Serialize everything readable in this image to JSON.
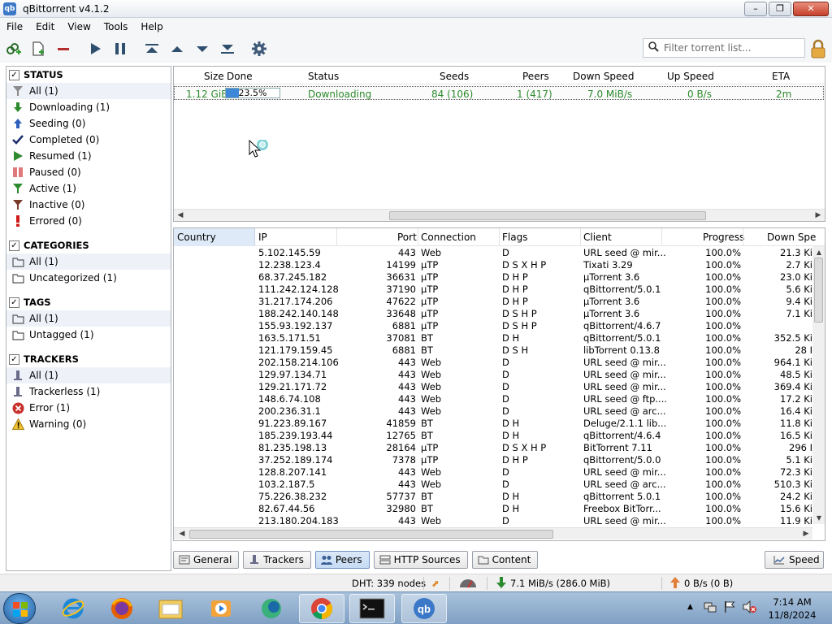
{
  "window": {
    "title": "qBittorrent v4.1.2"
  },
  "menu": [
    "File",
    "Edit",
    "View",
    "Tools",
    "Help"
  ],
  "toolbar": {
    "filter_placeholder": "Filter torrent list..."
  },
  "sidebar": {
    "status_header": "STATUS",
    "status_items": [
      {
        "label": "All (1)",
        "icon": "filter-icon"
      },
      {
        "label": "Downloading (1)",
        "icon": "arrow-down-icon"
      },
      {
        "label": "Seeding (0)",
        "icon": "arrow-up-icon"
      },
      {
        "label": "Completed (0)",
        "icon": "checkmark-icon"
      },
      {
        "label": "Resumed (1)",
        "icon": "play-icon"
      },
      {
        "label": "Paused (0)",
        "icon": "pause-icon"
      },
      {
        "label": "Active (1)",
        "icon": "filter-green-icon"
      },
      {
        "label": "Inactive (0)",
        "icon": "filter-red-icon"
      },
      {
        "label": "Errored (0)",
        "icon": "exclamation-icon"
      }
    ],
    "categories_header": "CATEGORIES",
    "categories_items": [
      "All (1)",
      "Uncategorized (1)"
    ],
    "tags_header": "TAGS",
    "tags_items": [
      "All (1)",
      "Untagged (1)"
    ],
    "trackers_header": "TRACKERS",
    "trackers_items": [
      {
        "label": "All (1)",
        "icon": "tracker-icon"
      },
      {
        "label": "Trackerless (1)",
        "icon": "tracker-icon"
      },
      {
        "label": "Error (1)",
        "icon": "error-icon"
      },
      {
        "label": "Warning (0)",
        "icon": "warning-icon"
      }
    ]
  },
  "torrents": {
    "columns": [
      "Size",
      "Done",
      "Status",
      "Seeds",
      "Peers",
      "Down Speed",
      "Up Speed",
      "ETA"
    ],
    "row": {
      "size": "1.12 GiB",
      "progress_text": "23.5%",
      "progress_fraction": 0.235,
      "status": "Downloading",
      "seeds": "84 (106)",
      "peers": "1 (417)",
      "down_speed": "7.0 MiB/s",
      "up_speed": "0 B/s",
      "eta": "2m"
    }
  },
  "peers": {
    "columns": [
      "Country",
      "IP",
      "Port",
      "Connection",
      "Flags",
      "Client",
      "Progress",
      "Down Spe"
    ],
    "rows": [
      [
        "5.102.145.59",
        "443",
        "Web",
        "D",
        "URL seed @ mir...",
        "100.0%",
        "21.3 Ki"
      ],
      [
        "12.238.123.4",
        "14199",
        "µTP",
        "D S X H P",
        "Tixati 3.29",
        "100.0%",
        "2.7 Ki"
      ],
      [
        "68.37.245.182",
        "36631",
        "µTP",
        "D H P",
        "µTorrent 3.6",
        "100.0%",
        "23.0 Ki"
      ],
      [
        "111.242.124.128",
        "37190",
        "µTP",
        "D H P",
        "qBittorrent/5.0.1",
        "100.0%",
        "5.6 Ki"
      ],
      [
        "31.217.174.206",
        "47622",
        "µTP",
        "D H P",
        "µTorrent 3.6",
        "100.0%",
        "9.4 Ki"
      ],
      [
        "188.242.140.148",
        "33648",
        "µTP",
        "D S H P",
        "µTorrent 3.6",
        "100.0%",
        "7.1 Ki"
      ],
      [
        "155.93.192.137",
        "6881",
        "µTP",
        "D S H P",
        "qBittorrent/4.6.7",
        "100.0%",
        ""
      ],
      [
        "163.5.171.51",
        "37081",
        "BT",
        "D H",
        "qBittorrent/5.0.1",
        "100.0%",
        "352.5 Ki"
      ],
      [
        "121.179.159.45",
        "6881",
        "BT",
        "D S H",
        "libTorrent 0.13.8",
        "100.0%",
        "28 I"
      ],
      [
        "202.158.214.106",
        "443",
        "Web",
        "D",
        "URL seed @ mir...",
        "100.0%",
        "964.1 Ki"
      ],
      [
        "129.97.134.71",
        "443",
        "Web",
        "D",
        "URL seed @ mir...",
        "100.0%",
        "48.5 Ki"
      ],
      [
        "129.21.171.72",
        "443",
        "Web",
        "D",
        "URL seed @ mir...",
        "100.0%",
        "369.4 Ki"
      ],
      [
        "148.6.74.108",
        "443",
        "Web",
        "D",
        "URL seed @ ftp....",
        "100.0%",
        "17.2 Ki"
      ],
      [
        "200.236.31.1",
        "443",
        "Web",
        "D",
        "URL seed @ arc...",
        "100.0%",
        "16.4 Ki"
      ],
      [
        "91.223.89.167",
        "41859",
        "BT",
        "D H",
        "Deluge/2.1.1 lib...",
        "100.0%",
        "11.8 Ki"
      ],
      [
        "185.239.193.44",
        "12765",
        "BT",
        "D H",
        "qBittorrent/4.6.4",
        "100.0%",
        "16.5 Ki"
      ],
      [
        "81.235.198.13",
        "28164",
        "µTP",
        "D S X H P",
        "BitTorrent 7.11",
        "100.0%",
        "296 I"
      ],
      [
        "37.252.189.174",
        "7378",
        "µTP",
        "D H P",
        "qBittorrent/5.0.0",
        "100.0%",
        "5.1 Ki"
      ],
      [
        "128.8.207.141",
        "443",
        "Web",
        "D",
        "URL seed @ mir...",
        "100.0%",
        "72.3 Ki"
      ],
      [
        "103.2.187.5",
        "443",
        "Web",
        "D",
        "URL seed @ arc...",
        "100.0%",
        "510.3 Ki"
      ],
      [
        "75.226.38.232",
        "57737",
        "BT",
        "D H",
        "qBittorrent 5.0.1",
        "100.0%",
        "24.2 Ki"
      ],
      [
        "82.67.44.56",
        "32980",
        "BT",
        "D H",
        "Freebox BitTorr...",
        "100.0%",
        "15.6 Ki"
      ],
      [
        "213.180.204.183",
        "443",
        "Web",
        "D",
        "URL seed @ mir...",
        "100.0%",
        "11.9 Ki"
      ]
    ]
  },
  "tabs": [
    "General",
    "Trackers",
    "Peers",
    "HTTP Sources",
    "Content"
  ],
  "speed_button": "Speed",
  "statusbar": {
    "dht": "DHT: 339 nodes",
    "down": "7.1 MiB/s (286.0 MiB)",
    "up": "0 B/s (0 B)"
  },
  "taskbar": {
    "time": "7:14 AM",
    "date": "11/8/2024"
  },
  "colors": {
    "accent": "#3d87d8",
    "downloading": "#2d8a2d",
    "selected_tab": "#c6dbf4"
  }
}
